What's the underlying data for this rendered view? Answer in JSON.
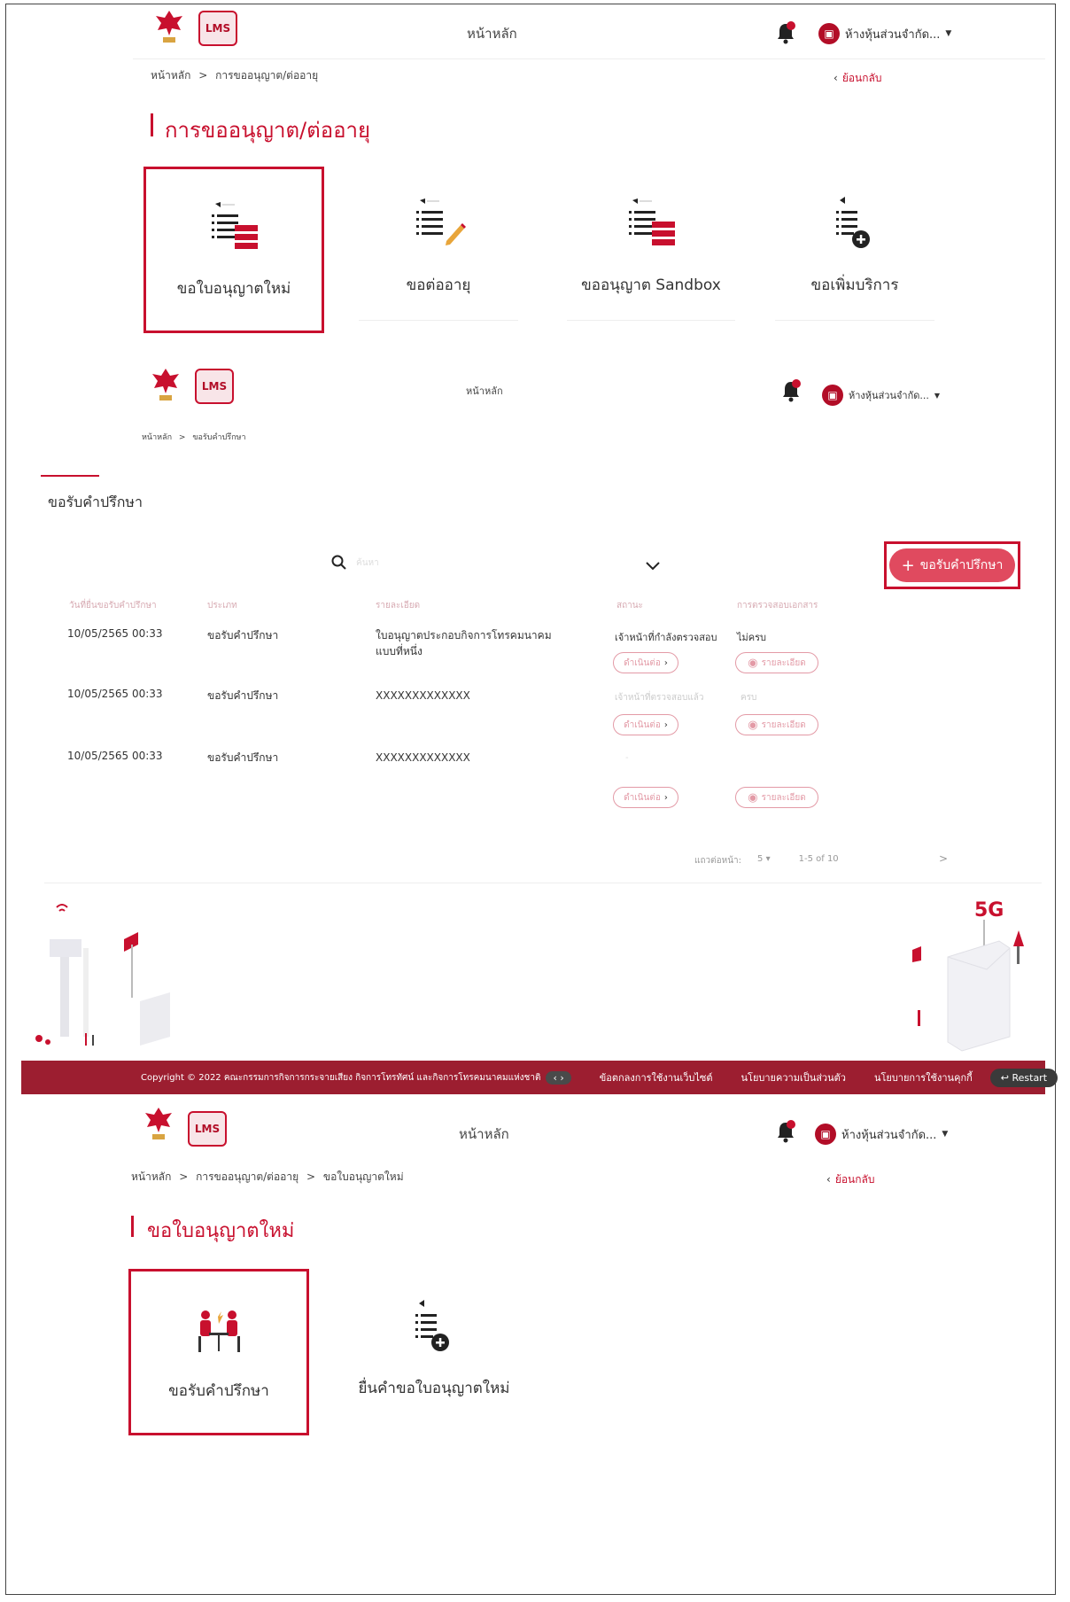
{
  "colors": {
    "brand_red": "#c8102e",
    "footer_red": "#9c1e30",
    "cta_pink": "#e04a5f"
  },
  "section1": {
    "header": {
      "title": "หน้าหลัก",
      "company": "ห้างหุ้นส่วนจำกัด...",
      "notification_count": "1",
      "logo_text": "LMS"
    },
    "breadcrumb": {
      "home": "หน้าหลัก",
      "sep": ">",
      "current": "การขออนุญาต/ต่ออายุ"
    },
    "back_label": "ย้อนกลับ",
    "page_title": "การขออนุญาต/ต่ออายุ",
    "cards": [
      {
        "label": "ขอใบอนุญาตใหม่",
        "icon": "list-form-icon"
      },
      {
        "label": "ขอต่ออายุ",
        "icon": "list-pencil-icon"
      },
      {
        "label": "ขออนุญาต Sandbox",
        "icon": "list-form-icon"
      },
      {
        "label": "ขอเพิ่มบริการ",
        "icon": "list-plus-icon"
      }
    ]
  },
  "section2": {
    "header": {
      "title": "หน้าหลัก",
      "company": "ห้างหุ้นส่วนจำกัด...",
      "notification_count": "1",
      "logo_text": "LMS"
    },
    "breadcrumb": {
      "home": "หน้าหลัก",
      "sep": ">",
      "current": "ขอรับคำปรึกษา"
    },
    "tab_label": "ขอรับคำปรึกษา",
    "search_placeholder": "ค้นหา",
    "new_button": "ขอรับคำปรึกษา",
    "table": {
      "columns": [
        "วันที่ยื่นขอรับคำปรึกษา",
        "ประเภท",
        "รายละเอียด",
        "สถานะ",
        "การตรวจสอบเอกสาร"
      ],
      "rows": [
        {
          "date": "10/05/2565  00:33",
          "type": "ขอรับคำปรึกษา",
          "detail_1": "ใบอนุญาตประกอบกิจการโทรคมนาคม",
          "detail_2": "แบบที่หนึ่ง",
          "status": "เจ้าหน้าที่กำลังตรวจสอบ",
          "doc": "ไม่ครบ",
          "action": "ดำเนินต่อ",
          "view": "รายละเอียด"
        },
        {
          "date": "10/05/2565  00:33",
          "type": "ขอรับคำปรึกษา",
          "detail_1": "XXXXXXXXXXXXX",
          "detail_2": "",
          "status": "เจ้าหน้าที่ตรวจสอบแล้ว",
          "doc": "ครบ",
          "action": "ดำเนินต่อ",
          "view": "รายละเอียด"
        },
        {
          "date": "10/05/2565  00:33",
          "type": "ขอรับคำปรึกษา",
          "detail_1": "XXXXXXXXXXXXX",
          "detail_2": "",
          "status": "-",
          "doc": "",
          "action": "ดำเนินต่อ",
          "view": "รายละเอียด"
        }
      ]
    },
    "pagination": {
      "rows_label": "แถวต่อหน้า:",
      "rows_value": "5",
      "range": "1-5 of 10",
      "next": ">"
    },
    "illustration_label": "5G",
    "footer": {
      "copyright": "Copyright © 2022 คณะกรรมการกิจการกระจายเสียง กิจการโทรทัศน์ และกิจการโทรคมนาคมแห่งชาติ",
      "links": [
        "ข้อตกลงการใช้งานเว็บไซต์",
        "นโยบายความเป็นส่วนตัว",
        "นโยบายการใช้งานคุกกี้"
      ],
      "restart": "Restart"
    }
  },
  "section3": {
    "header": {
      "title": "หน้าหลัก",
      "company": "ห้างหุ้นส่วนจำกัด...",
      "notification_count": "1",
      "logo_text": "LMS"
    },
    "breadcrumb": {
      "home": "หน้าหลัก",
      "sep": ">",
      "mid": "การขออนุญาต/ต่ออายุ",
      "current": "ขอใบอนุญาตใหม่"
    },
    "back_label": "ย้อนกลับ",
    "page_title": "ขอใบอนุญาตใหม่",
    "cards": [
      {
        "label": "ขอรับคำปรึกษา",
        "icon": "consultation-icon"
      },
      {
        "label": "ยื่นคำขอใบอนุญาตใหม่",
        "icon": "list-plus-icon"
      }
    ]
  }
}
